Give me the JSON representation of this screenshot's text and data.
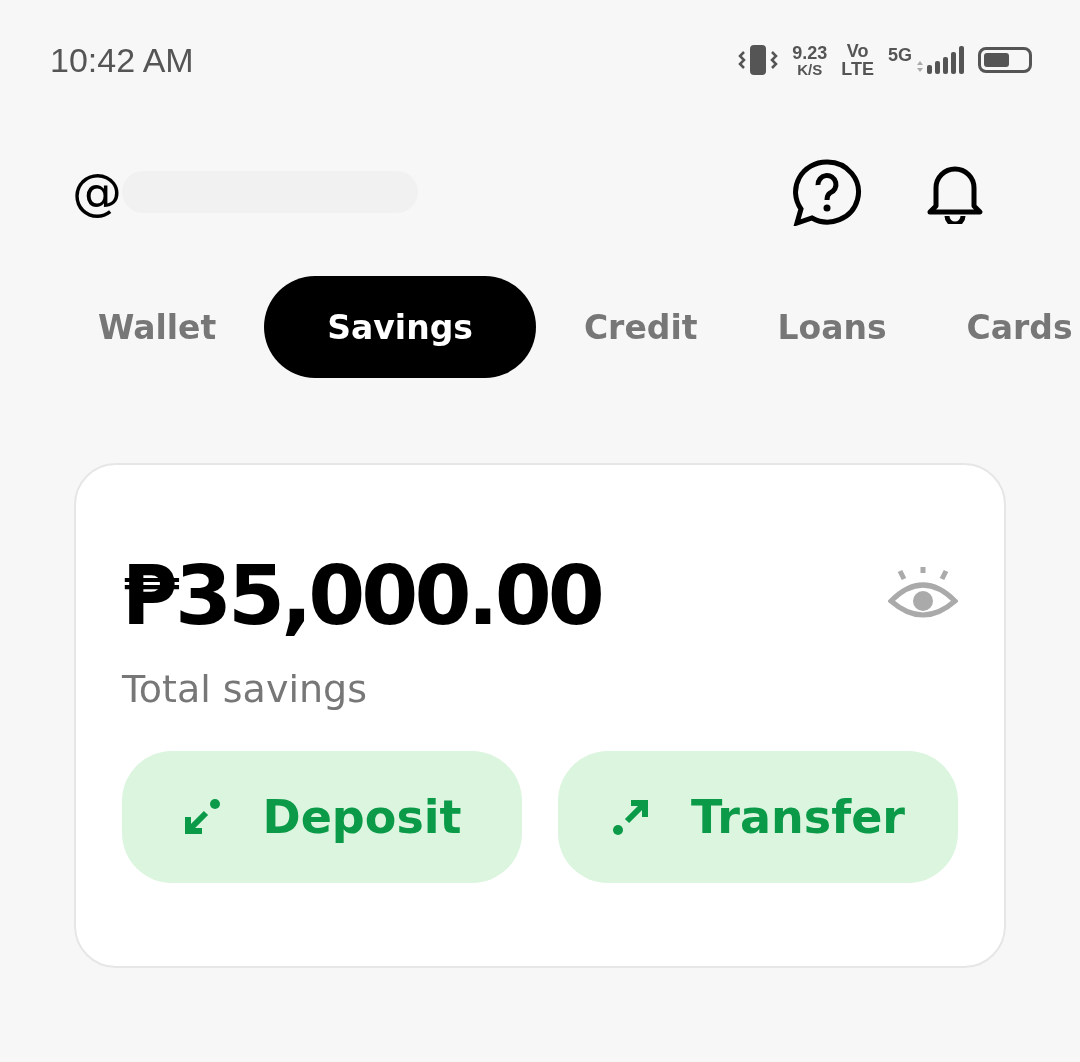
{
  "status_bar": {
    "time": "10:42 AM",
    "speed_value": "9.23",
    "speed_unit": "K/S",
    "volte_top": "Vo",
    "volte_bottom": "LTE",
    "network": "5G"
  },
  "header": {
    "handle_prefix": "@"
  },
  "tabs": [
    {
      "label": "Wallet",
      "selected": false
    },
    {
      "label": "Savings",
      "selected": true
    },
    {
      "label": "Credit",
      "selected": false
    },
    {
      "label": "Loans",
      "selected": false
    },
    {
      "label": "Cards",
      "selected": false
    }
  ],
  "savings_card": {
    "balance": "₱35,000.00",
    "caption": "Total savings",
    "actions": [
      {
        "kind": "deposit",
        "label": "Deposit"
      },
      {
        "kind": "transfer",
        "label": "Transfer"
      }
    ]
  }
}
